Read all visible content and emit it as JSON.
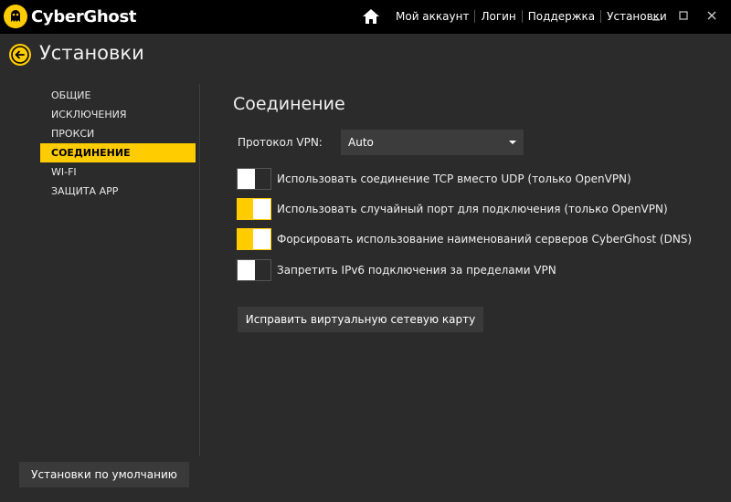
{
  "app": {
    "name": "CyberGhost"
  },
  "topnav": {
    "items": [
      "Мой аккаунт",
      "Логин",
      "Поддержка",
      "Установки"
    ]
  },
  "header": {
    "title": "Установки"
  },
  "sidebar": {
    "items": [
      {
        "label": "ОБЩИЕ"
      },
      {
        "label": "ИСКЛЮЧЕНИЯ"
      },
      {
        "label": "ПРОКСИ"
      },
      {
        "label": "СОЕДИНЕНИЕ",
        "active": true
      },
      {
        "label": "WI-FI"
      },
      {
        "label": "ЗАЩИТА APP"
      }
    ]
  },
  "content": {
    "title": "Соединение",
    "protocol": {
      "label": "Протокол VPN:",
      "value": "Auto"
    },
    "options": [
      {
        "label": "Использовать соединение TCP вместо UDP (только OpenVPN)",
        "enabled": false
      },
      {
        "label": "Использовать случайный порт для подключения (только OpenVPN)",
        "enabled": true
      },
      {
        "label": "Форсировать использование наименований серверов CyberGhost (DNS)",
        "enabled": true
      },
      {
        "label": "Запретить IPv6 подключения за пределами VPN",
        "enabled": false
      }
    ],
    "fix_button": "Исправить виртуальную сетевую карту"
  },
  "footer": {
    "reset_button": "Установки по умолчанию"
  },
  "colors": {
    "accent": "#ffcc00",
    "background": "#2b2b2b",
    "topbar": "#000000"
  }
}
